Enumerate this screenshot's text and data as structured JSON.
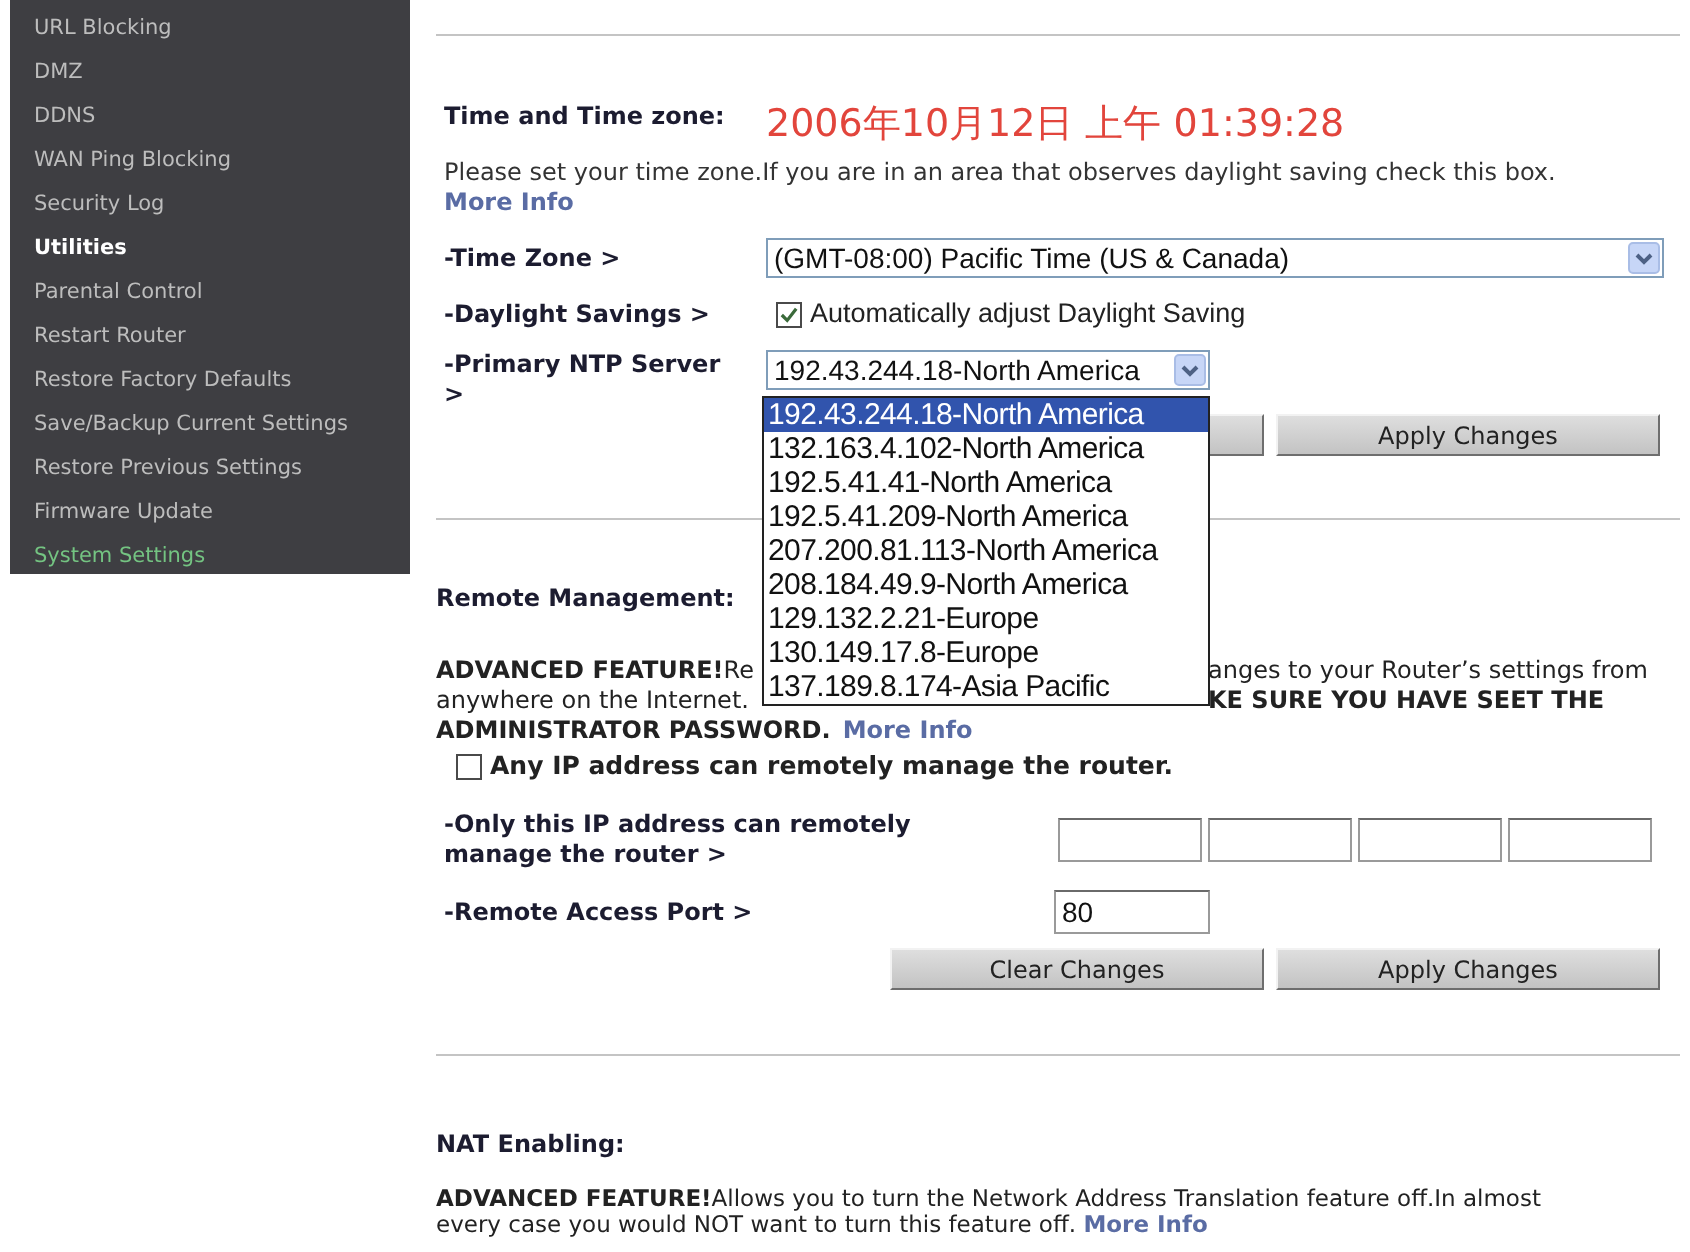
{
  "sidebar": {
    "groups": [
      {
        "items": [
          {
            "label": "URL Blocking",
            "selected": false
          },
          {
            "label": "DMZ",
            "selected": false
          },
          {
            "label": "DDNS",
            "selected": false
          },
          {
            "label": "WAN Ping Blocking",
            "selected": false
          },
          {
            "label": "Security Log",
            "selected": false
          }
        ]
      },
      {
        "heading": "Utilities",
        "items": [
          {
            "label": "Parental Control",
            "selected": false
          },
          {
            "label": "Restart Router",
            "selected": false
          },
          {
            "label": "Restore Factory Defaults",
            "selected": false
          },
          {
            "label": "Save/Backup Current Settings",
            "selected": false
          },
          {
            "label": "Restore Previous Settings",
            "selected": false
          },
          {
            "label": "Firmware Update",
            "selected": false
          },
          {
            "label": "System Settings",
            "selected": true
          }
        ]
      }
    ]
  },
  "time_settings": {
    "title": "Time and Time zone:",
    "current_time": "2006年10月12日 上午 01:39:28",
    "description": "Please set your time zone.If you are in an area that observes daylight saving check this box.",
    "more_info": "More Info",
    "time_zone": {
      "label": "-Time Zone >",
      "value": "(GMT-08:00) Pacific Time (US & Canada)"
    },
    "daylight_savings": {
      "label": "-Daylight Savings >",
      "option": "Automatically adjust Daylight Saving",
      "checked": true
    },
    "ntp_server": {
      "label": "-Primary NTP Server >",
      "value": "192.43.244.18-North America",
      "expanded": true,
      "options": [
        {
          "label": "192.43.244.18-North America",
          "selected": true
        },
        {
          "label": "132.163.4.102-North America",
          "selected": false
        },
        {
          "label": "192.5.41.41-North America",
          "selected": false
        },
        {
          "label": "192.5.41.209-North America",
          "selected": false
        },
        {
          "label": "207.200.81.113-North America",
          "selected": false
        },
        {
          "label": "208.184.49.9-North America",
          "selected": false
        },
        {
          "label": "129.132.2.21-Europe",
          "selected": false
        },
        {
          "label": "130.149.17.8-Europe",
          "selected": false
        },
        {
          "label": "137.189.8.174-Asia Pacific",
          "selected": false
        }
      ]
    },
    "buttons": [
      {
        "kind": "covered"
      },
      {
        "kind": "apply",
        "label": "Apply Changes"
      }
    ]
  },
  "remote_management": {
    "title": "Remote Management:",
    "notice_lines": [
      {
        "left": "**ADVANCED FEATURE!**Re",
        "right": "anges to your Router’s settings from"
      },
      {
        "left": "anywhere on the Internet.",
        "right": "**KE SURE YOU HAVE SEET THE**"
      }
    ],
    "notice_tail": "ADMINISTRATOR PASSWORD.",
    "more_info": "More Info",
    "any_ip": {
      "label": "Any IP address can remotely manage the router.",
      "checked": false
    },
    "only_ip": {
      "label": "-Only this IP address can remotely manage the router >"
    },
    "port": {
      "label": "-Remote Access Port >",
      "value": "80"
    },
    "buttons": [
      {
        "kind": "clear",
        "label": "Clear Changes"
      },
      {
        "kind": "apply",
        "label": "Apply Changes"
      }
    ]
  },
  "nat": {
    "title": "NAT Enabling:",
    "notice": "**ADVANCED FEATURE!**Allows you to turn the Network Address Translation feature off.In almost every case you would NOT want to turn this feature off.",
    "more_info": "More Info"
  }
}
